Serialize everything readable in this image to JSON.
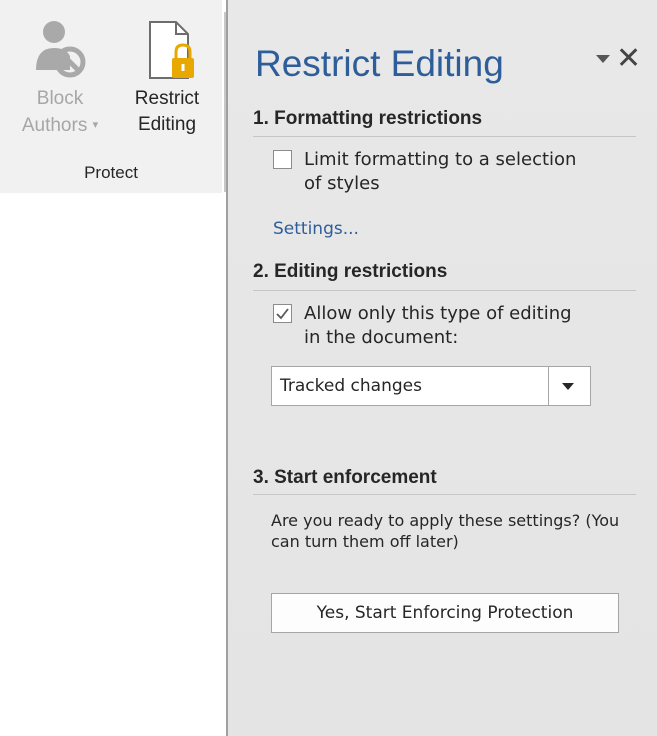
{
  "ribbon": {
    "block_authors": {
      "line1": "Block",
      "line2": "Authors",
      "caret": "▾",
      "icon": "block-authors-icon"
    },
    "restrict_editing": {
      "line1": "Restrict",
      "line2": "Editing",
      "icon": "restrict-editing-icon"
    },
    "group_label": "Protect"
  },
  "pane": {
    "title": "Restrict Editing",
    "close_label": "✕",
    "sections": {
      "formatting": {
        "heading": "1. Formatting restrictions",
        "checkbox_label_line1": "Limit formatting to a selection",
        "checkbox_label_line2": "of styles",
        "checked": false,
        "settings_link": "Settings..."
      },
      "editing": {
        "heading": "2. Editing restrictions",
        "checkbox_label_line1": "Allow only this type of editing",
        "checkbox_label_line2": "in the document:",
        "checked": true,
        "selected_option": "Tracked changes"
      },
      "enforcement": {
        "heading": "3. Start enforcement",
        "description": "Are you ready to apply these settings? (You can turn them off later)",
        "button_label": "Yes, Start Enforcing Protection"
      }
    }
  },
  "colors": {
    "accent": "#2e5e9a",
    "pane_bg": "#e6e6e6",
    "ribbon_bg": "#f1f1f1",
    "lock_gold": "#e8a800"
  }
}
